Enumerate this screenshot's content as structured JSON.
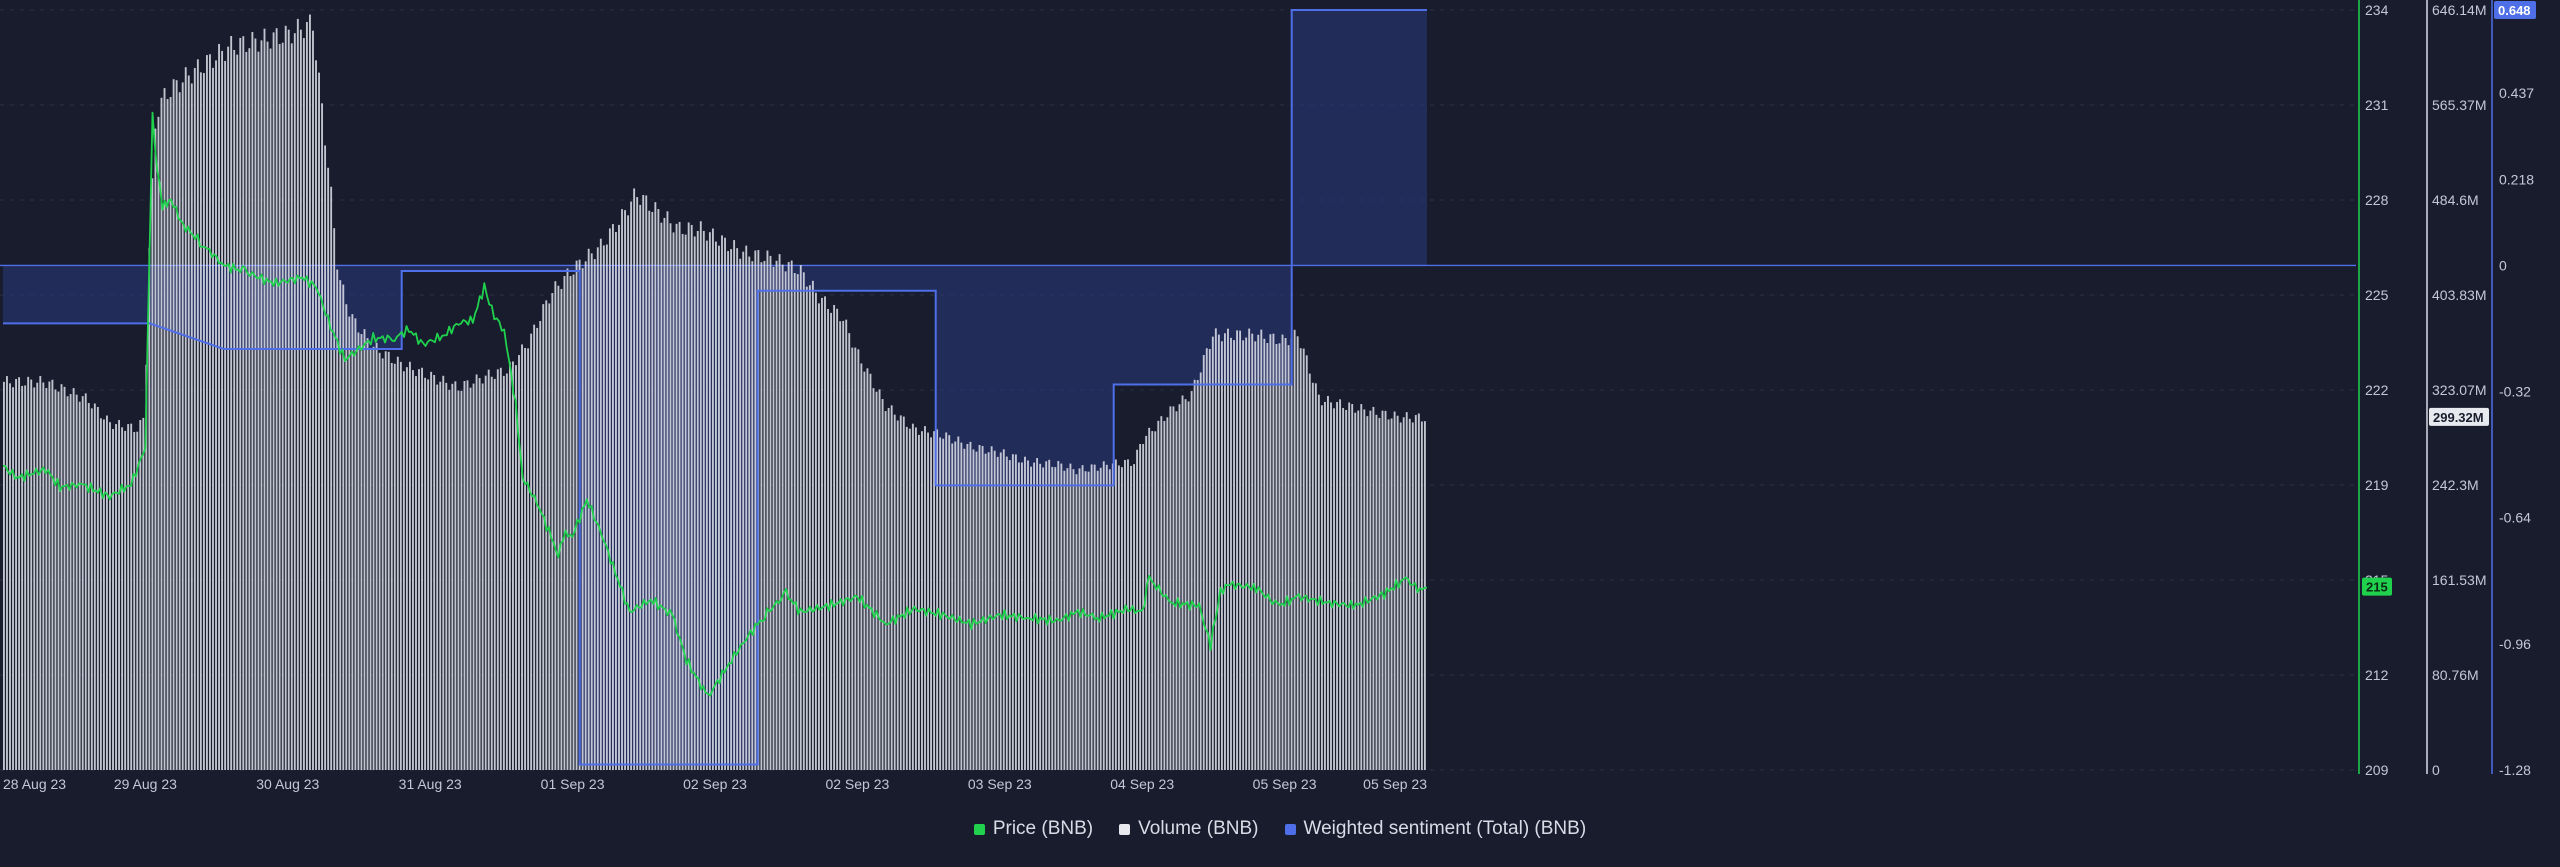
{
  "chart_data": {
    "type": "line",
    "title": "",
    "x": {
      "labels": [
        "28 Aug 23",
        "29 Aug 23",
        "30 Aug 23",
        "31 Aug 23",
        "01 Sep 23",
        "02 Sep 23",
        "02 Sep 23",
        "03 Sep 23",
        "04 Sep 23",
        "05 Sep 23",
        "05 Sep 23"
      ],
      "range": [
        "28 Aug 23",
        "05 Sep 23"
      ]
    },
    "axes": {
      "price": {
        "ticks": [
          "234",
          "231",
          "228",
          "225",
          "222",
          "219",
          "215",
          "212",
          "209"
        ],
        "range": [
          209,
          234
        ],
        "current": "215",
        "color": "#1fd14d"
      },
      "volume": {
        "ticks": [
          "646.14M",
          "565.37M",
          "484.6M",
          "403.83M",
          "323.07M",
          "242.3M",
          "161.53M",
          "80.76M",
          "0"
        ],
        "range": [
          0,
          646.14
        ],
        "unit": "M",
        "current": "299.32M",
        "color": "#e8e9ef"
      },
      "sentiment": {
        "ticks": [
          "0.648",
          "0.437",
          "0.218",
          "0",
          "-0.32",
          "-0.64",
          "-0.96",
          "-1.28"
        ],
        "range": [
          -1.28,
          0.648
        ],
        "current": "0.648",
        "color": "#4f6fe8"
      }
    },
    "series": [
      {
        "name": "Price (BNB)",
        "axis": "price",
        "color": "#1fd14d",
        "points": [
          [
            0.0,
            219.0
          ],
          [
            0.1,
            218.6
          ],
          [
            0.3,
            218.9
          ],
          [
            0.4,
            218.3
          ],
          [
            0.55,
            218.4
          ],
          [
            0.75,
            218.0
          ],
          [
            0.9,
            218.4
          ],
          [
            1.0,
            219.6
          ],
          [
            1.02,
            224.0
          ],
          [
            1.05,
            230.5
          ],
          [
            1.08,
            229.0
          ],
          [
            1.12,
            227.5
          ],
          [
            1.18,
            227.8
          ],
          [
            1.25,
            227.0
          ],
          [
            1.4,
            226.3
          ],
          [
            1.55,
            225.6
          ],
          [
            1.7,
            225.4
          ],
          [
            1.9,
            225.0
          ],
          [
            2.1,
            225.2
          ],
          [
            2.2,
            224.9
          ],
          [
            2.3,
            223.6
          ],
          [
            2.4,
            222.5
          ],
          [
            2.6,
            223.2
          ],
          [
            2.75,
            223.2
          ],
          [
            2.85,
            223.5
          ],
          [
            2.95,
            223.0
          ],
          [
            3.1,
            223.3
          ],
          [
            3.2,
            223.7
          ],
          [
            3.3,
            223.8
          ],
          [
            3.38,
            224.9
          ],
          [
            3.45,
            223.9
          ],
          [
            3.52,
            223.5
          ],
          [
            3.6,
            221.0
          ],
          [
            3.65,
            218.6
          ],
          [
            3.75,
            217.8
          ],
          [
            3.9,
            216.1
          ],
          [
            3.95,
            216.8
          ],
          [
            4.0,
            216.7
          ],
          [
            4.1,
            217.9
          ],
          [
            4.2,
            216.8
          ],
          [
            4.3,
            215.5
          ],
          [
            4.4,
            214.2
          ],
          [
            4.55,
            214.6
          ],
          [
            4.7,
            214.1
          ],
          [
            4.8,
            212.6
          ],
          [
            4.95,
            211.4
          ],
          [
            5.1,
            212.5
          ],
          [
            5.2,
            213.2
          ],
          [
            5.35,
            214.1
          ],
          [
            5.5,
            214.8
          ],
          [
            5.6,
            214.2
          ],
          [
            5.8,
            214.4
          ],
          [
            6.0,
            214.7
          ],
          [
            6.2,
            213.8
          ],
          [
            6.4,
            214.3
          ],
          [
            6.6,
            214.1
          ],
          [
            6.8,
            213.8
          ],
          [
            7.0,
            214.1
          ],
          [
            7.2,
            214.0
          ],
          [
            7.4,
            213.9
          ],
          [
            7.55,
            214.2
          ],
          [
            7.7,
            214.0
          ],
          [
            7.9,
            214.3
          ],
          [
            8.0,
            214.2
          ],
          [
            8.05,
            215.3
          ],
          [
            8.2,
            214.5
          ],
          [
            8.4,
            214.4
          ],
          [
            8.48,
            213.1
          ],
          [
            8.55,
            214.9
          ],
          [
            8.62,
            215.1
          ],
          [
            8.8,
            215.0
          ],
          [
            8.95,
            214.4
          ],
          [
            9.1,
            214.7
          ],
          [
            9.3,
            214.5
          ],
          [
            9.5,
            214.4
          ],
          [
            9.7,
            214.8
          ],
          [
            9.85,
            215.3
          ],
          [
            9.95,
            214.9
          ],
          [
            10.0,
            215.0
          ]
        ]
      },
      {
        "name": "Volume (BNB)",
        "axis": "volume",
        "color": "#e8e9ef",
        "points": [
          [
            0.0,
            330
          ],
          [
            0.3,
            330
          ],
          [
            0.6,
            315
          ],
          [
            0.75,
            295
          ],
          [
            0.95,
            290
          ],
          [
            1.0,
            300
          ],
          [
            1.03,
            440
          ],
          [
            1.08,
            560
          ],
          [
            1.15,
            575
          ],
          [
            1.3,
            590
          ],
          [
            1.6,
            615
          ],
          [
            1.8,
            620
          ],
          [
            2.0,
            625
          ],
          [
            2.18,
            635
          ],
          [
            2.3,
            500
          ],
          [
            2.36,
            420
          ],
          [
            2.45,
            385
          ],
          [
            2.6,
            360
          ],
          [
            2.8,
            345
          ],
          [
            3.0,
            335
          ],
          [
            3.2,
            325
          ],
          [
            3.4,
            335
          ],
          [
            3.55,
            340
          ],
          [
            3.7,
            365
          ],
          [
            3.85,
            405
          ],
          [
            4.0,
            425
          ],
          [
            4.2,
            445
          ],
          [
            4.35,
            470
          ],
          [
            4.45,
            490
          ],
          [
            4.6,
            475
          ],
          [
            4.75,
            460
          ],
          [
            4.9,
            460
          ],
          [
            5.2,
            440
          ],
          [
            5.4,
            435
          ],
          [
            5.6,
            425
          ],
          [
            5.75,
            400
          ],
          [
            5.9,
            385
          ],
          [
            6.0,
            355
          ],
          [
            6.2,
            310
          ],
          [
            6.4,
            290
          ],
          [
            6.6,
            285
          ],
          [
            6.8,
            275
          ],
          [
            7.0,
            270
          ],
          [
            7.2,
            262
          ],
          [
            7.4,
            260
          ],
          [
            7.55,
            255
          ],
          [
            7.8,
            260
          ],
          [
            7.95,
            262
          ],
          [
            8.0,
            280
          ],
          [
            8.2,
            305
          ],
          [
            8.35,
            320
          ],
          [
            8.5,
            370
          ],
          [
            8.8,
            370
          ],
          [
            9.0,
            365
          ],
          [
            9.1,
            370
          ],
          [
            9.25,
            315
          ],
          [
            9.6,
            305
          ],
          [
            9.8,
            300
          ],
          [
            10.0,
            299.32
          ]
        ]
      },
      {
        "name": "Weighted sentiment (Total) (BNB)",
        "axis": "sentiment",
        "color": "#4f6fe8",
        "steps": [
          [
            0.0,
            -0.147
          ],
          [
            1.03,
            -0.147
          ],
          [
            1.55,
            -0.212
          ],
          [
            2.8,
            -0.212
          ],
          [
            2.8,
            -0.014
          ],
          [
            4.05,
            -0.014
          ],
          [
            4.05,
            -1.266
          ],
          [
            5.3,
            -1.266
          ],
          [
            5.3,
            -0.064
          ],
          [
            6.55,
            -0.064
          ],
          [
            6.55,
            -0.558
          ],
          [
            7.8,
            -0.558
          ],
          [
            7.8,
            -0.302
          ],
          [
            9.05,
            -0.302
          ],
          [
            9.05,
            0.648
          ],
          [
            10.0,
            0.648
          ]
        ]
      }
    ],
    "legend": [
      {
        "label": "Price (BNB)",
        "color": "#1fd14d"
      },
      {
        "label": "Volume (BNB)",
        "color": "#e8e9ef"
      },
      {
        "label": "Weighted sentiment (Total) (BNB)",
        "color": "#4f6fe8"
      }
    ]
  }
}
